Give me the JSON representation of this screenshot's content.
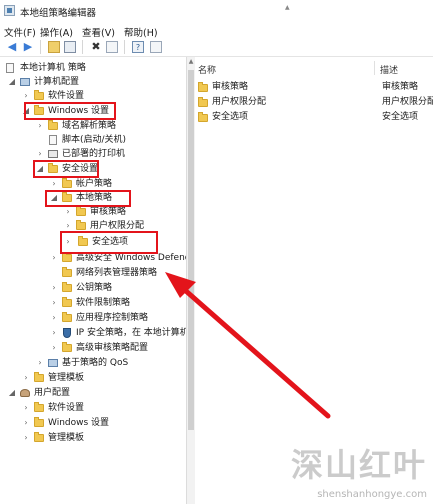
{
  "window": {
    "title": "本地组策略编辑器"
  },
  "menu": [
    "文件(F)",
    "操作(A)",
    "查看(V)",
    "帮助(H)"
  ],
  "toolbar": {
    "help_label": "?",
    "icons": [
      "back-arrow-icon",
      "forward-arrow-icon",
      "up-folder-icon",
      "show-hide-tree-icon",
      "delete-icon",
      "export-list-icon",
      "help-icon",
      "properties-icon"
    ]
  },
  "tree": {
    "root": "本地计算机 策略",
    "computer_config": "计算机配置",
    "software_settings": "软件设置",
    "windows_settings": "Windows 设置",
    "name_resolution_policy": "域名解析策略",
    "scripts": "脚本(启动/关机)",
    "deployed_printers": "已部署的打印机",
    "security_settings": "安全设置",
    "account_policies": "帐户策略",
    "local_policies": "本地策略",
    "audit_policy": "审核策略",
    "user_rights": "用户权限分配",
    "security_options": "安全选项",
    "advanced_firewall": "高级安全 Windows Defender 防火墙",
    "network_list_manager": "网络列表管理器策略",
    "public_key_policies": "公钥策略",
    "software_restriction": "软件限制策略",
    "app_control": "应用程序控制策略",
    "ip_security": "IP 安全策略，在 本地计算机",
    "advanced_audit": "高级审核策略配置",
    "policy_qos": "基于策略的 QoS",
    "admin_templates": "管理模板",
    "user_config": "用户配置",
    "user_software_settings": "软件设置",
    "user_windows_settings": "Windows 设置",
    "user_admin_templates": "管理模板"
  },
  "list": {
    "columns": {
      "name": "名称",
      "description": "描述"
    },
    "rows": [
      {
        "name": "审核策略",
        "description": "审核策略"
      },
      {
        "name": "用户权限分配",
        "description": "用户权限分配"
      },
      {
        "name": "安全选项",
        "description": "安全选项"
      }
    ]
  },
  "watermark": {
    "main": "深山红叶",
    "sub": "shenshanhongye.com"
  },
  "colors": {
    "highlight": "#e3141b",
    "folder": "#f1c851"
  }
}
